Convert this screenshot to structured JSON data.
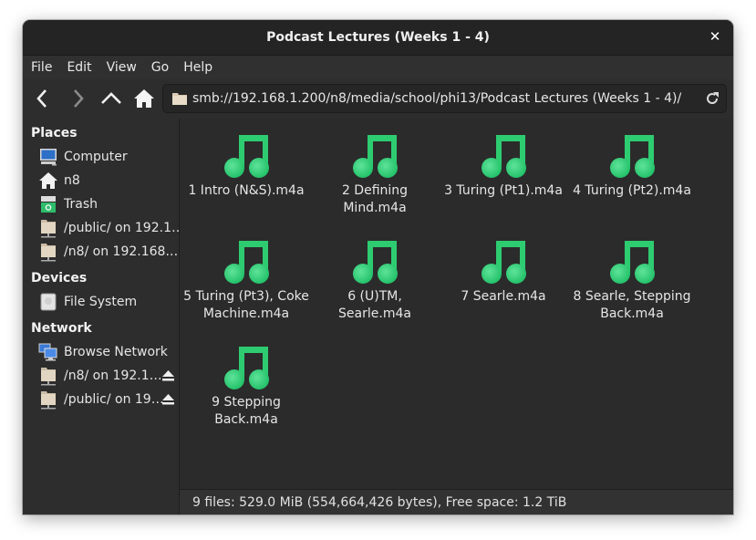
{
  "window": {
    "title": "Podcast Lectures (Weeks 1 - 4)",
    "close_icon": "close-icon"
  },
  "menubar": {
    "items": [
      "File",
      "Edit",
      "View",
      "Go",
      "Help"
    ]
  },
  "toolbar": {
    "back_icon": "chevron-left-icon",
    "forward_icon": "chevron-right-icon",
    "up_icon": "chevron-up-icon",
    "home_icon": "home-icon",
    "location": "smb://192.168.1.200/n8/media/school/phi13/Podcast Lectures (Weeks 1 - 4)/",
    "reload_icon": "reload-icon"
  },
  "sidebar": {
    "places": {
      "heading": "Places",
      "items": [
        {
          "label": "Computer",
          "icon": "computer-icon"
        },
        {
          "label": "n8",
          "icon": "home-icon"
        },
        {
          "label": "Trash",
          "icon": "trash-icon"
        },
        {
          "label": "/public/ on 192.1…",
          "icon": "network-folder-icon"
        },
        {
          "label": "/n8/ on 192.168.…",
          "icon": "network-folder-icon"
        }
      ]
    },
    "devices": {
      "heading": "Devices",
      "items": [
        {
          "label": "File System",
          "icon": "drive-icon"
        }
      ]
    },
    "network": {
      "heading": "Network",
      "items": [
        {
          "label": "Browse Network",
          "icon": "network-icon"
        },
        {
          "label": "/n8/ on 192.1…",
          "icon": "network-folder-icon",
          "eject": true
        },
        {
          "label": "/public/ on 19…",
          "icon": "network-folder-icon",
          "eject": true
        }
      ]
    }
  },
  "files": [
    {
      "name": "1 Intro (N&S).m4a",
      "icon": "audio-file-icon"
    },
    {
      "name": "2 Defining Mind.m4a",
      "icon": "audio-file-icon"
    },
    {
      "name": "3 Turing (Pt1).m4a",
      "icon": "audio-file-icon"
    },
    {
      "name": "4 Turing (Pt2).m4a",
      "icon": "audio-file-icon"
    },
    {
      "name": "5 Turing (Pt3), Coke Machine.m4a",
      "icon": "audio-file-icon"
    },
    {
      "name": "6 (U)TM, Searle.m4a",
      "icon": "audio-file-icon"
    },
    {
      "name": "7 Searle.m4a",
      "icon": "audio-file-icon"
    },
    {
      "name": "8 Searle, Stepping Back.m4a",
      "icon": "audio-file-icon"
    },
    {
      "name": "9 Stepping Back.m4a",
      "icon": "audio-file-icon"
    }
  ],
  "statusbar": {
    "text": "9 files: 529.0 MiB (554,664,426 bytes), Free space: 1.2 TiB"
  },
  "colors": {
    "accent_green": "#2ecc71",
    "background": "#2b2b2b",
    "text": "#e6e6e6"
  }
}
